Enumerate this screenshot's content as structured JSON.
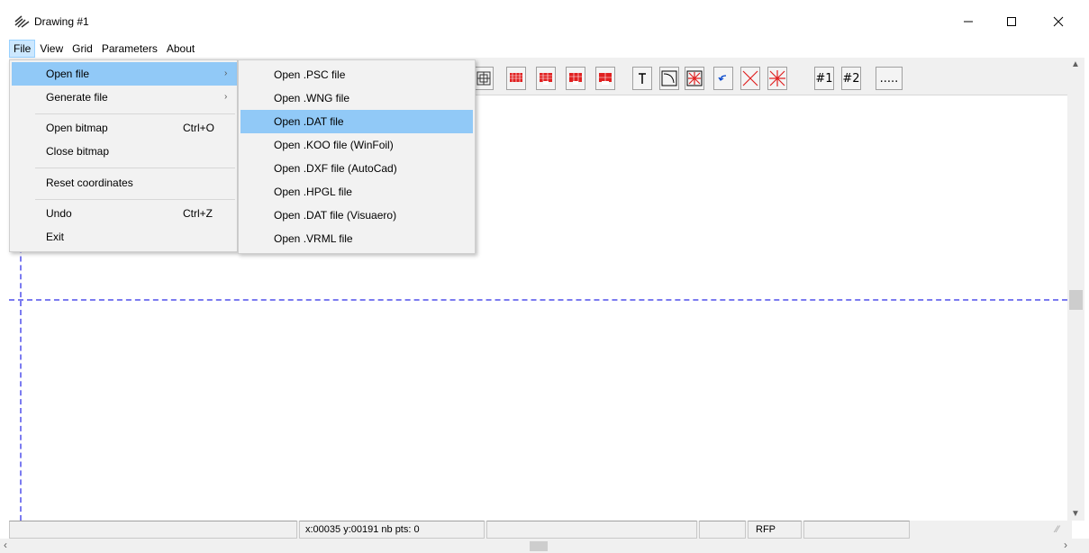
{
  "window": {
    "title": "Drawing #1",
    "controls": {
      "minimize": "–",
      "maximize": "☐",
      "close": "✕"
    }
  },
  "menubar": {
    "items": [
      {
        "label": "File",
        "active": true
      },
      {
        "label": "View"
      },
      {
        "label": "Grid"
      },
      {
        "label": "Parameters"
      },
      {
        "label": "About"
      }
    ]
  },
  "file_menu": {
    "items": [
      {
        "label": "Open file",
        "arrow": "›",
        "highlighted": true
      },
      {
        "label": "Generate file",
        "arrow": "›"
      },
      {
        "label": "Open bitmap",
        "shortcut": "Ctrl+O"
      },
      {
        "label": "Close bitmap"
      },
      {
        "label": "Reset coordinates"
      },
      {
        "label": "Undo",
        "shortcut": "Ctrl+Z"
      },
      {
        "label": "Exit"
      }
    ]
  },
  "open_file_submenu": {
    "items": [
      {
        "label": "Open .PSC file"
      },
      {
        "label": "Open .WNG file"
      },
      {
        "label": "Open .DAT file",
        "highlighted": true
      },
      {
        "label": "Open .KOO file (WinFoil)"
      },
      {
        "label": "Open .DXF file (AutoCad)"
      },
      {
        "label": "Open .HPGL file"
      },
      {
        "label": "Open .DAT file (Visuaero)"
      },
      {
        "label": "Open .VRML file"
      }
    ]
  },
  "toolbar": {
    "grid1_label": "#1",
    "grid2_label": "#2",
    "more_label": "....."
  },
  "statusbar": {
    "coords": "x:00035 y:00191 nb pts:   0",
    "mode": "RFP"
  },
  "colors": {
    "guide_lines": "#7b7bf0",
    "menu_highlight": "#91c9f7",
    "red_icons": "#e02020"
  }
}
